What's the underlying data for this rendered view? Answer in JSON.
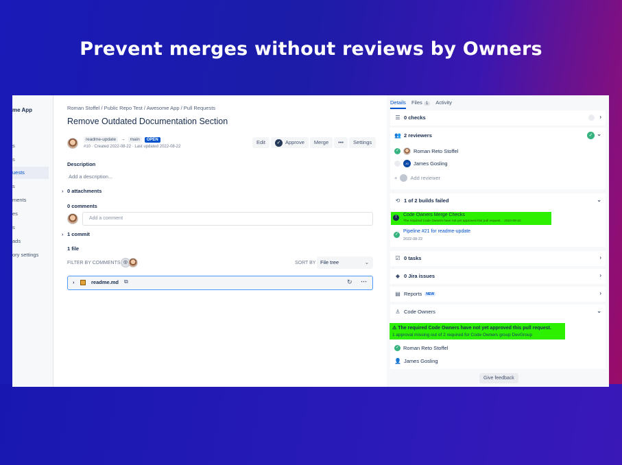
{
  "headline": "Prevent merges without reviews by Owners",
  "sidebar": {
    "project_name": "me App",
    "items": [
      {
        "label": "s"
      },
      {
        "label": "s"
      },
      {
        "label": "uests"
      },
      {
        "label": "s"
      },
      {
        "label": "ments"
      },
      {
        "label": "es"
      },
      {
        "label": "s"
      },
      {
        "label": "ads"
      },
      {
        "label": "ory settings"
      }
    ]
  },
  "breadcrumb": {
    "items": [
      "Roman Stoffel",
      "Public Repo Test",
      "Awesome App",
      "Pull Requests"
    ],
    "separator": "/"
  },
  "pull_request": {
    "title": "Remove Outdated Documentation Section",
    "source_branch": "readme-update",
    "arrow": "→",
    "target_branch": "main",
    "status": "OPEN",
    "meta": "#10 · Created 2022-08-22 · Last updated 2022-08-22"
  },
  "toolbar": {
    "edit": "Edit",
    "approve": "Approve",
    "merge": "Merge",
    "more": "•••",
    "settings": "Settings"
  },
  "description": {
    "heading": "Description",
    "placeholder": "Add a description..."
  },
  "attachments": "0 attachments",
  "comments": {
    "heading": "0 comments",
    "placeholder": "Add a comment"
  },
  "commits": "1 commit",
  "files": {
    "heading": "1 file",
    "filter_label": "FILTER BY COMMENTS",
    "sort_label": "SORT BY",
    "sort_value": "File tree",
    "file_name": "readme.md"
  },
  "right_panel": {
    "tabs": [
      {
        "label": "Details"
      },
      {
        "label": "Files",
        "count": "1"
      },
      {
        "label": "Activity"
      }
    ],
    "checks": "0 checks",
    "reviewers": {
      "heading": "2 reviewers",
      "list": [
        {
          "name": "Roman Reto Stoffel",
          "initials": ""
        },
        {
          "name": "James Gosling",
          "initials": "JG"
        }
      ],
      "add_label": "Add reviewer"
    },
    "builds": {
      "heading": "1 of 2 builds failed",
      "failed_title": "Code Owners Merge Checks",
      "failed_sub": "The required Code Owners have not yet approved this pull request.  ·  2022-08-22",
      "pipeline_title": "Pipeline #21 for readme-update",
      "pipeline_date": "2022-08-22"
    },
    "tasks": "0 tasks",
    "jira": "0 Jira issues",
    "reports": "Reports",
    "reports_badge": "NEW",
    "code_owners": {
      "heading": "Code Owners",
      "warning_title": "The required Code Owners have not yet approved this pull request.",
      "warning_detail": "1 approval missing out of 2 required for Code Owners group DevGroup",
      "owners": [
        "Roman Reto Stoffel",
        "James Gosling"
      ]
    },
    "feedback": "Give feedback"
  },
  "colors": {
    "primary": "#0052cc",
    "success": "#36b37e",
    "highlight": "#2cf000"
  }
}
